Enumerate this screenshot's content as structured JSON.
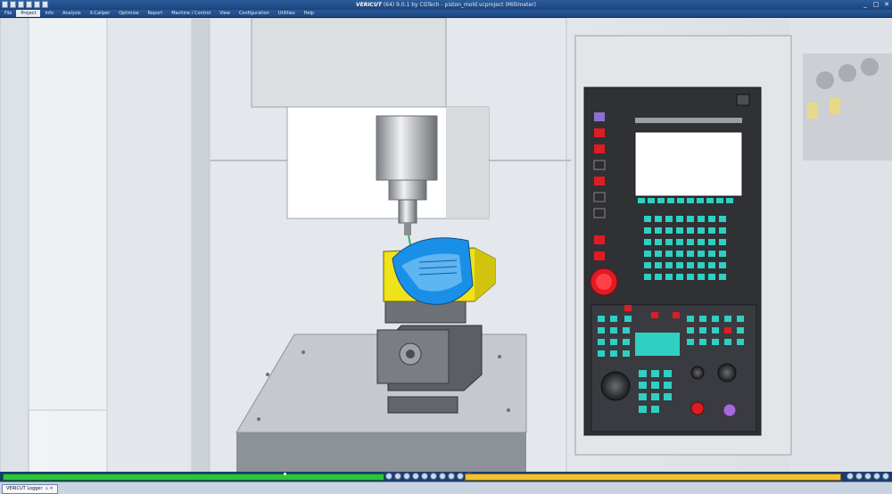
{
  "app": {
    "title_brand": "VERICUT",
    "title_rest": " (64)  9.0.1 by CGTech - piston_mold.vcproject (Millimeter)",
    "icons": [
      "new-icon",
      "open-icon",
      "save-icon",
      "undo-icon",
      "redo-icon",
      "print-icon"
    ]
  },
  "menu": {
    "items": [
      "File",
      "Project",
      "Info",
      "Analysis",
      "X-Caliper",
      "Optimize",
      "Report",
      "Machine / Control",
      "View",
      "Configuration",
      "Utilities",
      "Help"
    ],
    "active_index": 1
  },
  "window_buttons": [
    "_",
    "□",
    "✕"
  ],
  "status": {
    "progress_green": 0.43,
    "progress_yellow": 0.42
  },
  "taskbar": {
    "tab_label": "VERICUT Logger",
    "tab_controls": "▫ ✕"
  },
  "colors": {
    "part_blue": "#1a8fe8",
    "stock_yellow": "#f0e21a",
    "panel_dark": "#2f3135",
    "key_teal": "#2fd0c2",
    "key_red": "#e01c23"
  }
}
